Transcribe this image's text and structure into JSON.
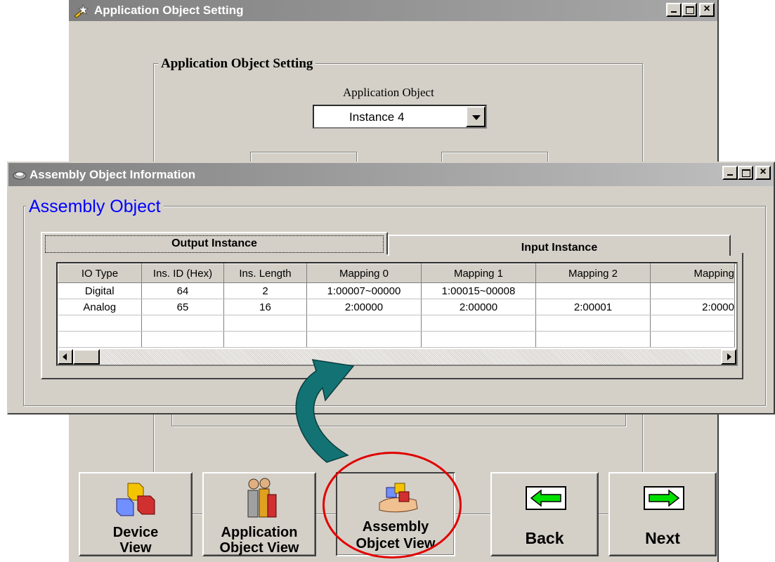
{
  "bg_window": {
    "title": "Application Object Setting",
    "group_title": "Application Object Setting",
    "field_label": "Application Object",
    "combo_value": "Instance  4"
  },
  "fg_window": {
    "title": "Assembly Object Information",
    "group_title": "Assembly Object",
    "tabs": [
      {
        "label": "Output Instance",
        "active": true
      },
      {
        "label": "Input Instance",
        "active": false
      }
    ],
    "table": {
      "headers": [
        "IO Type",
        "Ins. ID (Hex)",
        "Ins. Length",
        "Mapping  0",
        "Mapping  1",
        "Mapping  2",
        "Mapping"
      ],
      "rows": [
        [
          "Digital",
          "64",
          "2",
          "1:00007~00000",
          "1:00015~00008",
          "",
          ""
        ],
        [
          "Analog",
          "65",
          "16",
          "2:00000",
          "2:00000",
          "2:00001",
          "2:0000"
        ],
        [
          "",
          "",
          "",
          "",
          "",
          "",
          ""
        ],
        [
          "",
          "",
          "",
          "",
          "",
          "",
          ""
        ]
      ]
    }
  },
  "buttons": {
    "device_view": [
      "Device",
      "View"
    ],
    "app_object_view": [
      "Application",
      "Object View"
    ],
    "assembly_view": [
      "Assembly",
      "Objcet View"
    ],
    "back": "Back",
    "next": "Next"
  },
  "colors": {
    "face": "#d4d0c8",
    "group_title_blue": "#0000ff",
    "arrow": "#137374",
    "highlight": "#e00000",
    "nav_arrow": "#00e000"
  }
}
